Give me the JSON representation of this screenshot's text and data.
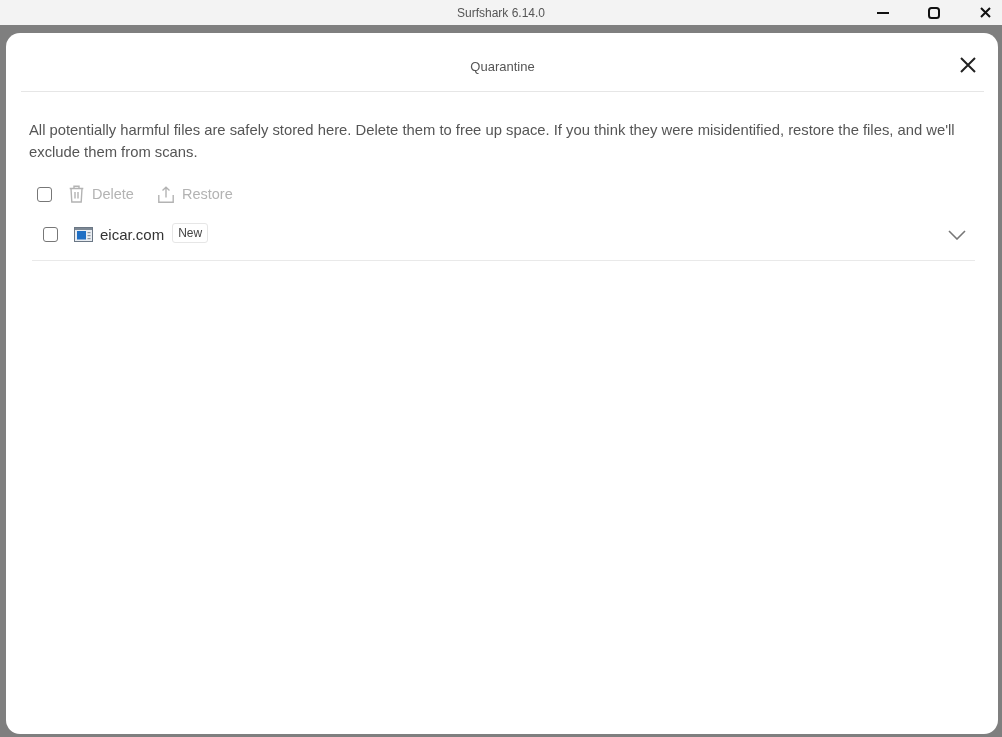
{
  "window": {
    "title": "Surfshark 6.14.0"
  },
  "dialog": {
    "title": "Quarantine",
    "description": "All potentially harmful files are safely stored here. Delete them to free up space. If you think they were misidentified, restore the files, and we'll exclude them from scans.",
    "toolbar": {
      "select_all": {
        "checked": false
      },
      "actions": [
        {
          "kind": "delete",
          "label": "Delete",
          "disabled": true
        },
        {
          "kind": "restore",
          "label": "Restore",
          "disabled": true
        }
      ]
    },
    "files": [
      {
        "name": "eicar.com",
        "badge": "New",
        "checked": false,
        "expanded": false
      }
    ]
  }
}
